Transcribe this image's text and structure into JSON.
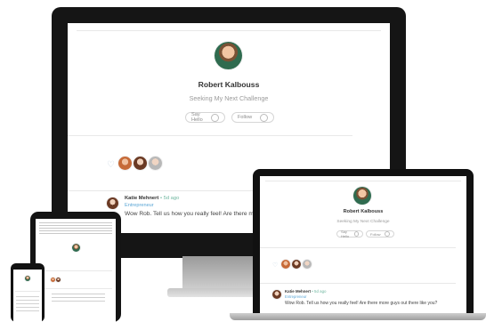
{
  "profile": {
    "name": "Robert Kalbouss",
    "tagline": "Seeking My Next Challenge",
    "say_hello_label": "Say Hello",
    "follow_label": "Follow"
  },
  "comment": {
    "author": "Katie Mehnert",
    "badge": "• 5d ago",
    "role": "Entrepreneur",
    "text_desktop": "Wow Rob.  Tell us how you really feel! Are there m",
    "text_laptop": "Wow Rob.  Tell us how you really feel! Are there more guys out there like you?"
  },
  "colors": {
    "screen_frame": "#141414",
    "stand": "#bdbdbd",
    "accent_link": "#5aa6d6"
  },
  "icons": [
    "heart-icon",
    "avatar",
    "follow-circle-icon"
  ]
}
